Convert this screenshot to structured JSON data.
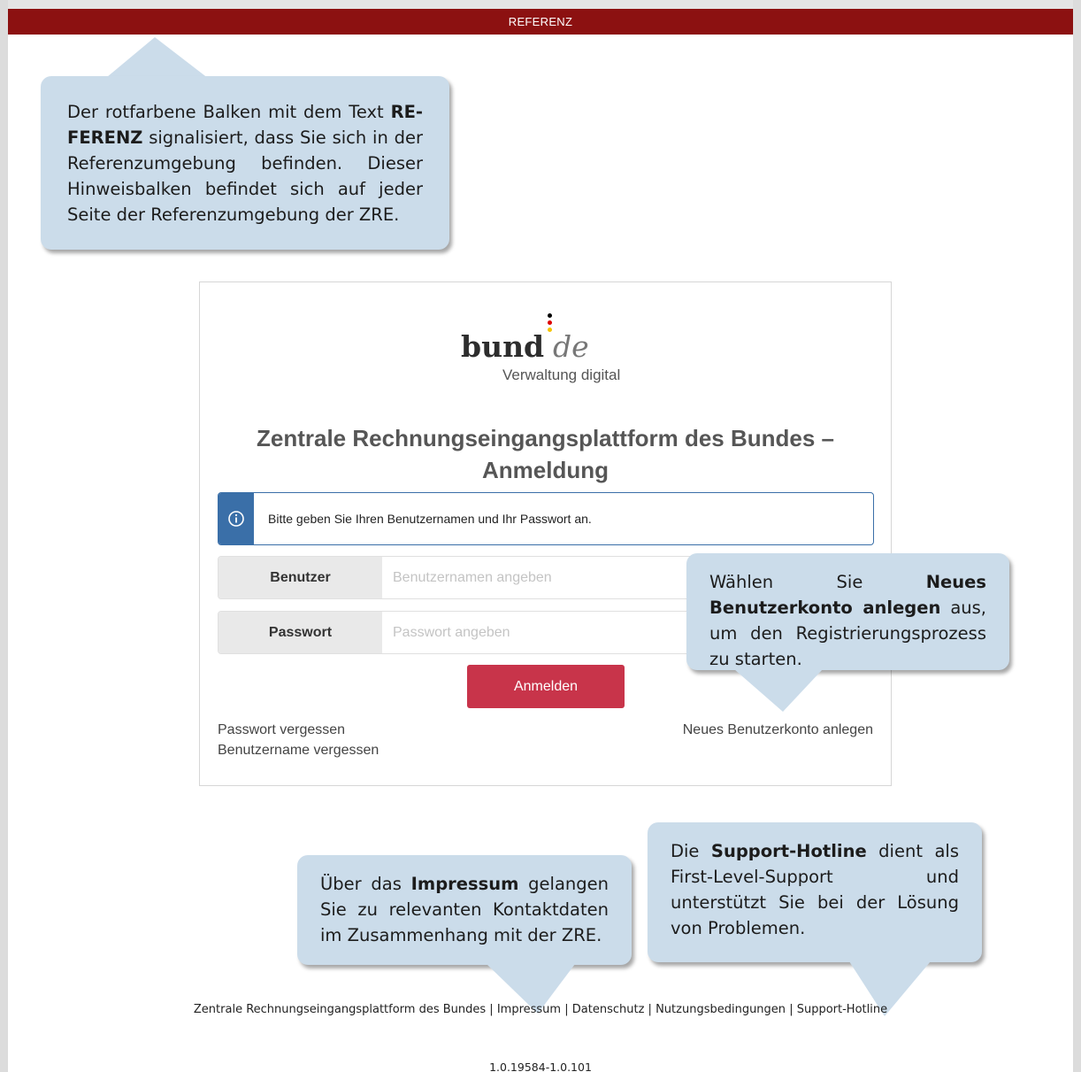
{
  "banner": {
    "text": "REFERENZ"
  },
  "logo": {
    "word": "bund",
    "suffix": "de",
    "subtitle": "Verwaltung digital"
  },
  "title": {
    "line1": "Zentrale Rechnungseingangsplattform des Bundes –",
    "line2": "Anmeldung"
  },
  "info": {
    "message": "Bitte geben Sie Ihren Benutzernamen und Ihr Passwort an."
  },
  "form": {
    "user_label": "Benutzer",
    "user_placeholder": "Benutzernamen angeben",
    "password_label": "Passwort",
    "password_placeholder": "Passwort angeben",
    "login_label": "Anmelden"
  },
  "links": {
    "forgot_password": "Passwort vergessen",
    "forgot_username": "Benutzername vergessen",
    "new_account": "Neues Benutzerkonto anlegen"
  },
  "footer": {
    "items": [
      "Zentrale Rechnungseingangsplattform des Bundes",
      "Impressum",
      "Datenschutz",
      "Nutzungsbedingungen",
      "Support-Hotline"
    ],
    "separator": "|",
    "version": "1.0.19584-1.0.101"
  },
  "callouts": {
    "referenz": {
      "t1": "Der rotfarbene Balken mit dem Text ",
      "b1": "RE-FERENZ",
      "t2": " signalisiert, dass Sie sich in der Referenzumgebung befinden. Dieser Hinweisbalken befindet sich auf jeder Seite der Referenzumgebung der ZRE."
    },
    "account": {
      "t1": "Wählen Sie ",
      "b1": "Neues Benutzerkonto anlegen",
      "t2": " aus, um den Registrierungsprozess zu starten."
    },
    "impressum": {
      "t1": "Über das ",
      "b1": "Impressum",
      "t2": " gelangen Sie zu relevanten Kontaktdaten im Zusammenhang mit der ZRE."
    },
    "hotline": {
      "t1": "Die ",
      "b1": "Support-Hotline",
      "t2": " dient als First-Level-Support und unterstützt Sie bei der Lösung von Problemen."
    }
  },
  "colors": {
    "banner": "#8c1111",
    "login_button": "#c8344a",
    "info_accent": "#3a6fa8",
    "callout": "#cbdcea"
  }
}
